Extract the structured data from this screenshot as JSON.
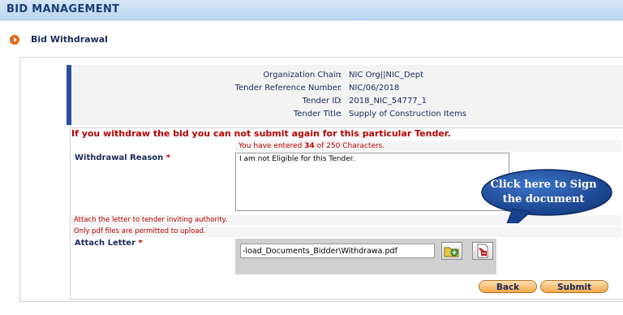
{
  "header": {
    "title": "BID MANAGEMENT"
  },
  "section": {
    "title": "Bid Withdrawal"
  },
  "info": [
    {
      "label": "Organization Chain",
      "value": "NIC Org||NIC_Dept"
    },
    {
      "label": "Tender Reference Number",
      "value": "NIC/06/2018"
    },
    {
      "label": "Tender ID",
      "value": "2018_NIC_54777_1"
    },
    {
      "label": "Tender Title",
      "value": "Supply of Construction Items"
    }
  ],
  "form": {
    "warning": "If you withdraw the bid you can not submit again for this particular Tender.",
    "counter": {
      "prefix": "You have entered",
      "count": "34",
      "suffix": "of 250 Characters."
    },
    "reason": {
      "label": "Withdrawal Reason",
      "value": "I am not Eligible for this Tender."
    },
    "required_mark": "*",
    "note_attach": "Attach the letter to tender inviting authority.",
    "note_pdf": "Only pdf files are permitted to upload.",
    "attach": {
      "label": "Attach Letter",
      "file_path": "-load_Documents_Bidder\\Withdrawa.pdf"
    }
  },
  "buttons": {
    "back": "Back",
    "submit": "Submit"
  },
  "callout": {
    "line1": "Click here to Sign",
    "line2": "the document"
  },
  "icons": [
    "browse-folder-icon",
    "sign-document-icon",
    "section-bullet-icon"
  ],
  "colors": {
    "header_bg": "#c8def4",
    "accent_blue": "#2a4f9c",
    "warning_red": "#b80000",
    "button_orange": "#f4a94a",
    "callout_blue": "#1f4fa0"
  }
}
